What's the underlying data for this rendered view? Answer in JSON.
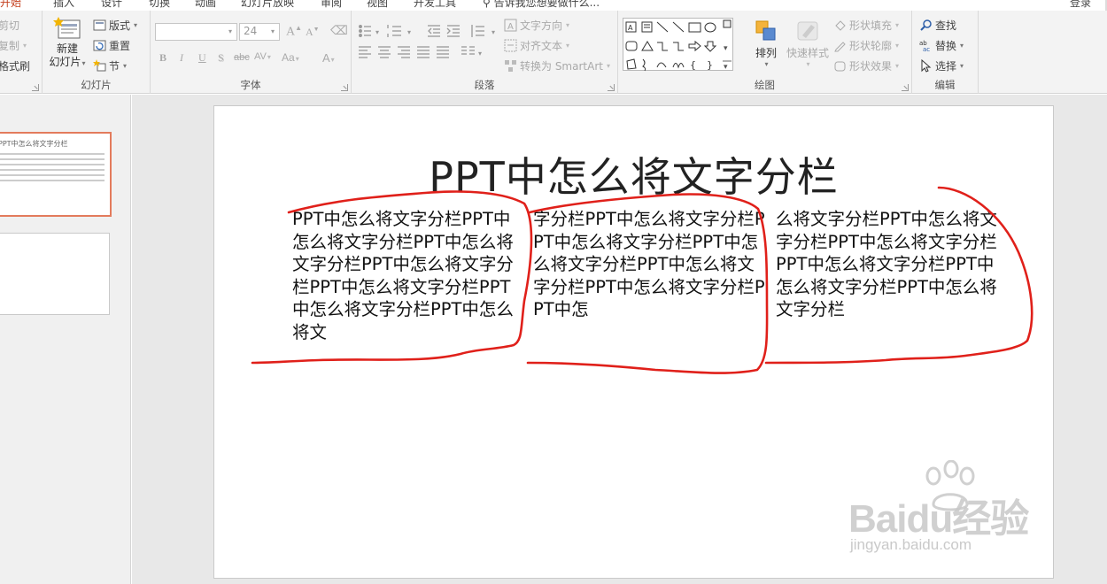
{
  "tabs": [
    "开始",
    "插入",
    "设计",
    "切换",
    "动画",
    "幻灯片放映",
    "审阅",
    "视图",
    "开发工具"
  ],
  "tell_me": "告诉我您想要做什么...",
  "login": "登录",
  "colors": {
    "accent": "#c43e1c",
    "thumb_border": "#e37b5c",
    "annotation": "#e0201a"
  },
  "clipboard": {
    "cut": "剪切",
    "copy": "复制",
    "format_painter": "格式刷"
  },
  "slides_group": {
    "label": "幻灯片",
    "new_slide_1": "新建",
    "new_slide_2": "幻灯片",
    "layout": "版式",
    "reset": "重置",
    "section": "节"
  },
  "font_group": {
    "label": "字体",
    "font_name": "",
    "font_size": "24",
    "bold": "B",
    "italic": "I",
    "underline": "U",
    "shadow": "S",
    "strike": "abc",
    "spacing": "AV",
    "case": "Aa",
    "color": "A"
  },
  "paragraph_group": {
    "label": "段落",
    "text_direction": "文字方向",
    "align_text": "对齐文本",
    "smartart": "转换为 SmartArt"
  },
  "drawing_group": {
    "label": "绘图",
    "arrange": "排列",
    "quick_styles": "快速样式",
    "shape_fill": "形状填充",
    "shape_outline": "形状轮廓",
    "shape_effects": "形状效果"
  },
  "editing_group": {
    "label": "编辑",
    "find": "查找",
    "replace": "替换",
    "select": "选择"
  },
  "thumbnail": {
    "title": "PPT中怎么将文字分栏"
  },
  "slide": {
    "title": "PPT中怎么将文字分栏",
    "col1": "PPT中怎么将文字分栏PPT中怎么将文字分栏PPT中怎么将文字分栏PPT中怎么将文字分栏PPT中怎么将文字分栏PPT中怎么将文字分栏PPT中怎么将文",
    "col2": "字分栏PPT中怎么将文字分栏PPT中怎么将文字分栏PPT中怎么将文字分栏PPT中怎么将文字分栏PPT中怎么将文字分栏PPT中怎",
    "col3": "么将文字分栏PPT中怎么将文字分栏PPT中怎么将文字分栏PPT中怎么将文字分栏PPT中怎么将文字分栏PPT中怎么将文字分栏"
  },
  "watermark": {
    "brand": "Baidu经验",
    "url": "jingyan.baidu.com"
  }
}
